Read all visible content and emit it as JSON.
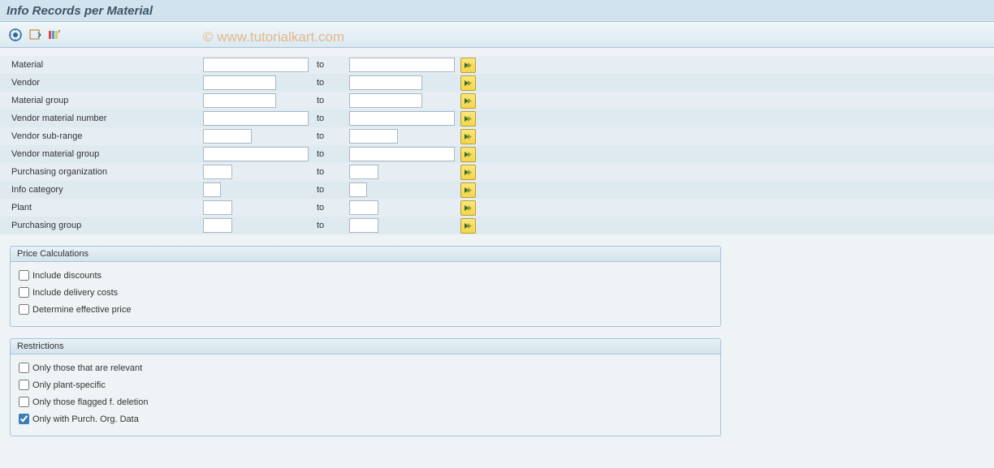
{
  "title": "Info Records per Material",
  "watermark": "© www.tutorialkart.com",
  "toolbar": {
    "icons": [
      "execute-icon",
      "variant-icon",
      "layout-icon"
    ]
  },
  "selection_rows": [
    {
      "label": "Material",
      "from_width": "w-lg",
      "to_width": "w-lg"
    },
    {
      "label": "Vendor",
      "from_width": "w-md",
      "to_width": "w-md"
    },
    {
      "label": "Material group",
      "from_width": "w-md",
      "to_width": "w-md"
    },
    {
      "label": "Vendor material number",
      "from_width": "w-lg",
      "to_width": "w-lg"
    },
    {
      "label": "Vendor sub-range",
      "from_width": "w-sm",
      "to_width": "w-sm"
    },
    {
      "label": "Vendor material group",
      "from_width": "w-lg",
      "to_width": "w-lg"
    },
    {
      "label": "Purchasing organization",
      "from_width": "w-xs",
      "to_width": "w-xs"
    },
    {
      "label": "Info category",
      "from_width": "w-xxs",
      "to_width": "w-xxs"
    },
    {
      "label": "Plant",
      "from_width": "w-xs",
      "to_width": "w-xs"
    },
    {
      "label": "Purchasing group",
      "from_width": "w-xs",
      "to_width": "w-xs"
    }
  ],
  "to_label": "to",
  "groups": {
    "price": {
      "header": "Price Calculations",
      "items": [
        {
          "label": "Include discounts",
          "checked": false
        },
        {
          "label": "Include delivery costs",
          "checked": false
        },
        {
          "label": "Determine effective price",
          "checked": false
        }
      ]
    },
    "restrictions": {
      "header": "Restrictions",
      "items": [
        {
          "label": "Only those that are relevant",
          "checked": false
        },
        {
          "label": "Only plant-specific",
          "checked": false
        },
        {
          "label": "Only those flagged f. deletion",
          "checked": false
        },
        {
          "label": "Only with Purch. Org. Data",
          "checked": true
        }
      ]
    }
  }
}
